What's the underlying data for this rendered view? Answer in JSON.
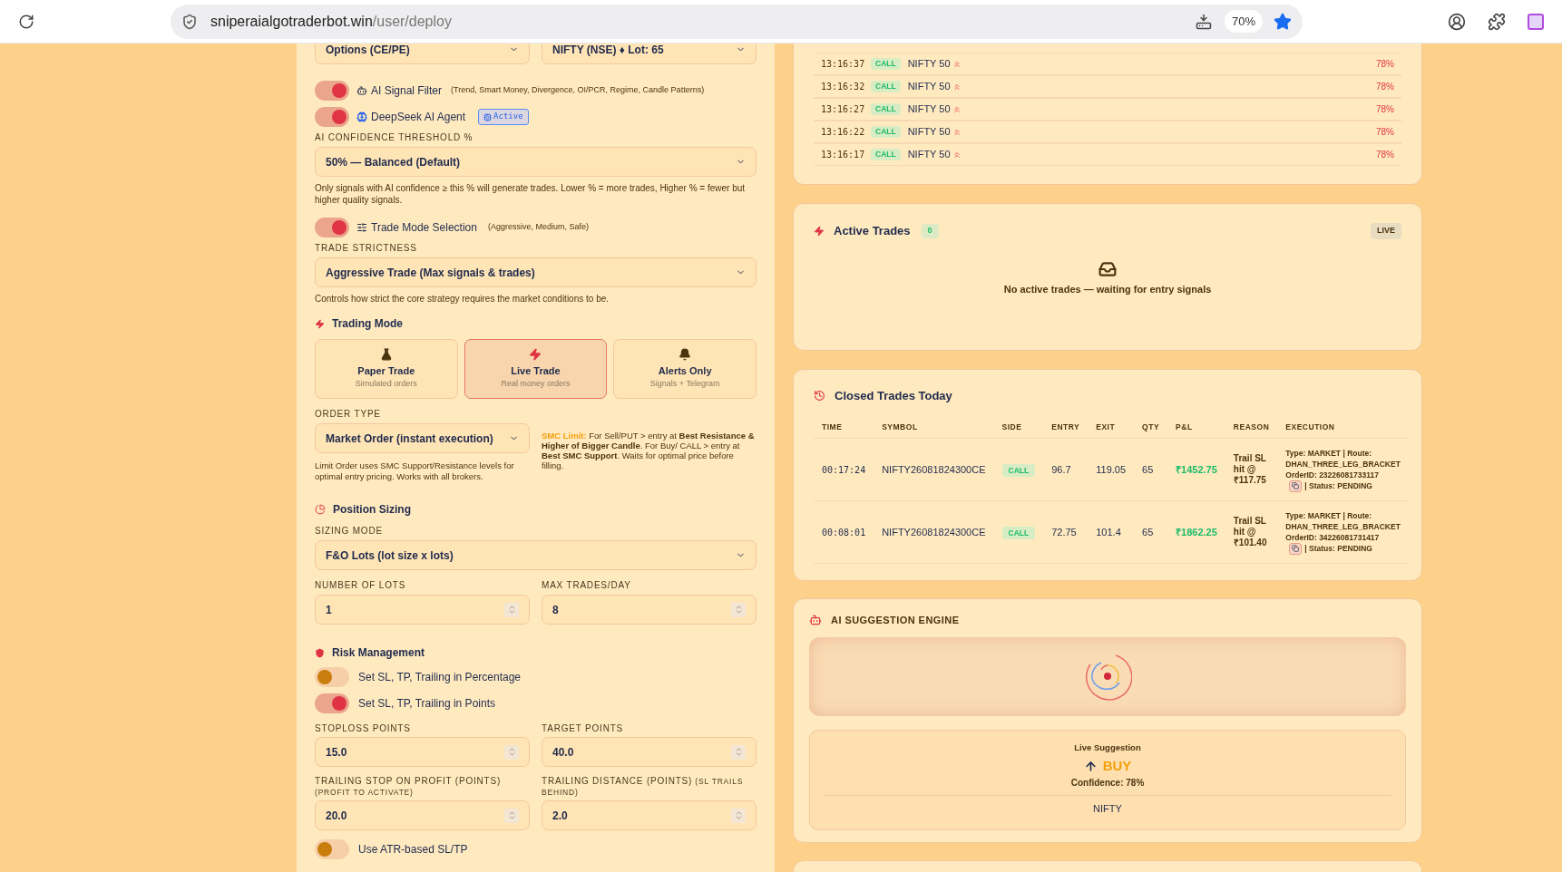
{
  "browser": {
    "url_host": "sniperaialgotraderbot.win",
    "url_path": "/user/deploy",
    "zoom": "70%",
    "bookmarked": true
  },
  "config": {
    "market_selects": [
      {
        "value": "Options (CE/PE)"
      },
      {
        "value": "NIFTY (NSE) ♦ Lot: 65"
      }
    ],
    "ai_filter": {
      "label": "AI Signal Filter",
      "hint": "(Trend, Smart Money, Divergence, OI/PCR, Regime, Candle Patterns)",
      "on": true
    },
    "deepseek": {
      "label": "DeepSeek AI Agent",
      "badge": "Active",
      "on": true
    },
    "confidence": {
      "label": "AI CONFIDENCE THRESHOLD %",
      "value": "50% — Balanced (Default)",
      "help": "Only signals with AI confidence ≥ this % will generate trades. Lower % = more trades, Higher % = fewer but higher quality signals."
    },
    "trade_mode_toggle": {
      "label": "Trade Mode Selection",
      "hint": "(Aggressive, Medium, Safe)",
      "on": true
    },
    "strictness": {
      "label": "TRADE STRICTNESS",
      "value": "Aggressive Trade (Max signals & trades)",
      "help": "Controls how strict the core strategy requires the market conditions to be."
    },
    "trading_mode": {
      "title": "Trading Mode",
      "options": [
        {
          "kind": "paper",
          "title": "Paper Trade",
          "subtitle": "Simulated orders",
          "selected": false
        },
        {
          "kind": "live",
          "title": "Live Trade",
          "subtitle": "Real money orders",
          "selected": true
        },
        {
          "kind": "alerts",
          "title": "Alerts Only",
          "subtitle": "Signals + Telegram",
          "selected": false
        }
      ]
    },
    "order_type": {
      "label": "ORDER TYPE",
      "value": "Market Order (instant execution)",
      "help": "Limit Order uses SMC Support/Resistance levels for optimal entry pricing. Works with all brokers.",
      "smc_lead": "SMC Limit:",
      "smc_text": "For Sell/PUT > entry at **Best Resistance & Higher of Bigger Candle**. For Buy/ CALL > entry at **Best SMC Support**. Waits for optimal price before filling."
    },
    "position_sizing": {
      "title": "Position Sizing",
      "sizing_label": "SIZING MODE",
      "sizing_value": "F&O Lots (lot size x lots)",
      "fields": [
        {
          "label": "NUMBER OF LOTS",
          "value": "1"
        },
        {
          "label": "MAX TRADES/DAY",
          "value": "8"
        }
      ]
    },
    "risk": {
      "title": "Risk Management",
      "toggles": [
        {
          "label": "Set SL, TP, Trailing in Percentage",
          "on": false
        },
        {
          "label": "Set SL, TP, Trailing in Points",
          "on": true
        }
      ],
      "fields": [
        {
          "label": "STOPLOSS POINTS",
          "value": "15.0"
        },
        {
          "label": "TARGET POINTS",
          "value": "40.0"
        },
        {
          "label": "TRAILING STOP ON PROFIT (POINTS)",
          "sublabel": "(PROFIT TO ACTIVATE)",
          "value": "20.0"
        },
        {
          "label": "TRAILING DISTANCE (POINTS)",
          "sublabel": "(SL TRAILS BEHIND)",
          "value": "2.0"
        }
      ]
    },
    "atr": {
      "label": "Use ATR-based SL/TP",
      "on": false
    }
  },
  "signals": [
    {
      "time": "13:16:37",
      "side": "CALL",
      "symbol": "NIFTY 50",
      "confidence": "78%"
    },
    {
      "time": "13:16:32",
      "side": "CALL",
      "symbol": "NIFTY 50",
      "confidence": "78%"
    },
    {
      "time": "13:16:27",
      "side": "CALL",
      "symbol": "NIFTY 50",
      "confidence": "78%"
    },
    {
      "time": "13:16:22",
      "side": "CALL",
      "symbol": "NIFTY 50",
      "confidence": "78%"
    },
    {
      "time": "13:16:17",
      "side": "CALL",
      "symbol": "NIFTY 50",
      "confidence": "78%"
    }
  ],
  "active_trades": {
    "title": "Active Trades",
    "count": "0",
    "badge": "LIVE",
    "empty": "No active trades — waiting for entry signals"
  },
  "closed_trades": {
    "title": "Closed Trades Today",
    "columns": [
      "TIME",
      "SYMBOL",
      "SIDE",
      "ENTRY",
      "EXIT",
      "QTY",
      "P&L",
      "REASON",
      "EXECUTION"
    ],
    "rows": [
      {
        "time": "00:17:24",
        "symbol": "NIFTY26081824300CE",
        "side": "CALL",
        "entry": "96.7",
        "exit": "119.05",
        "qty": "65",
        "pnl": "₹1452.75",
        "reason": "Trail SL hit @ ₹117.75",
        "exec_main": "Type: **MARKET** | Route: **DHAN_THREE_LEG_BRACKET** OrderID: **23226081733117**",
        "exec_status": "| Status: **PENDING**"
      },
      {
        "time": "00:08:01",
        "symbol": "NIFTY26081824300CE",
        "side": "CALL",
        "entry": "72.75",
        "exit": "101.4",
        "qty": "65",
        "pnl": "₹1862.25",
        "reason": "Trail SL hit @ ₹101.40",
        "exec_main": "Type: **MARKET** | Route: **DHAN_THREE_LEG_BRACKET** OrderID: **34226081731417**",
        "exec_status": "| Status: **PENDING**"
      }
    ]
  },
  "ai_suggestion": {
    "title": "AI SUGGESTION ENGINE",
    "label": "Live Suggestion",
    "action": "BUY",
    "confidence": "Confidence: 78%",
    "symbol": "NIFTY"
  }
}
